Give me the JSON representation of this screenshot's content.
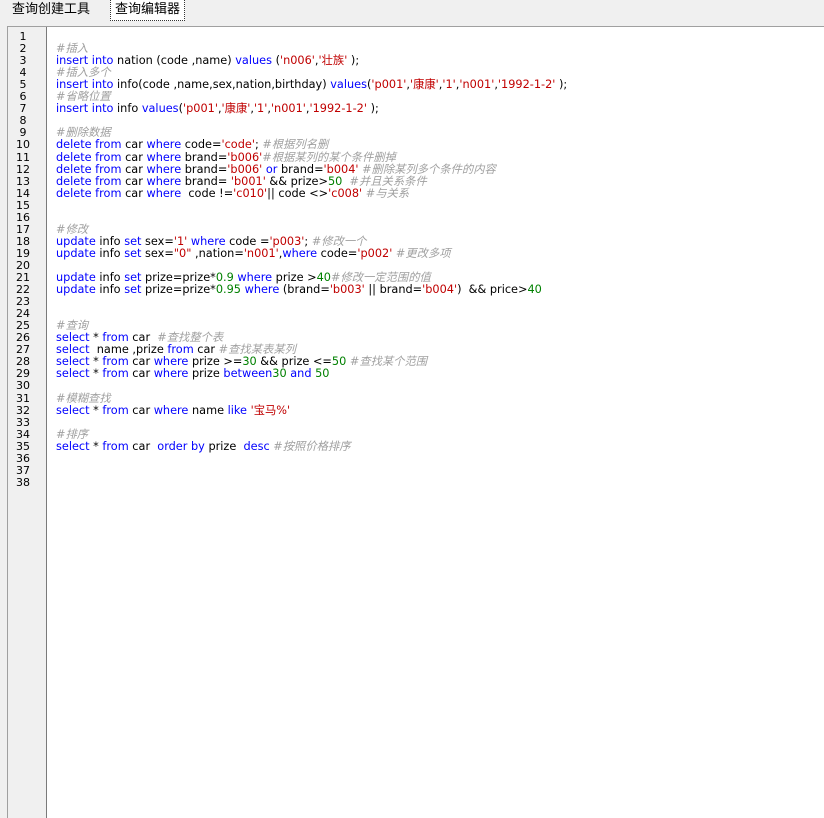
{
  "tabs": [
    {
      "label": "查询创建工具"
    },
    {
      "label": "查询编辑器"
    }
  ],
  "editor": {
    "line_count": 38,
    "lines": [
      [],
      [
        {
          "t": "cmt",
          "v": "#插入"
        }
      ],
      [
        {
          "t": "kw",
          "v": "insert into"
        },
        {
          "t": "txt",
          "v": " nation (code ,name) "
        },
        {
          "t": "kw",
          "v": "values"
        },
        {
          "t": "txt",
          "v": " ("
        },
        {
          "t": "str",
          "v": "'n006'"
        },
        {
          "t": "txt",
          "v": ","
        },
        {
          "t": "str",
          "v": "'壮族'"
        },
        {
          "t": "txt",
          "v": " );"
        }
      ],
      [
        {
          "t": "cmt",
          "v": "#插入多个"
        }
      ],
      [
        {
          "t": "kw",
          "v": "insert into"
        },
        {
          "t": "txt",
          "v": " info(code ,name,sex,nation,birthday) "
        },
        {
          "t": "kw",
          "v": "values"
        },
        {
          "t": "txt",
          "v": "("
        },
        {
          "t": "str",
          "v": "'p001'"
        },
        {
          "t": "txt",
          "v": ","
        },
        {
          "t": "str",
          "v": "'康康'"
        },
        {
          "t": "txt",
          "v": ","
        },
        {
          "t": "str",
          "v": "'1'"
        },
        {
          "t": "txt",
          "v": ","
        },
        {
          "t": "str",
          "v": "'n001'"
        },
        {
          "t": "txt",
          "v": ","
        },
        {
          "t": "str",
          "v": "'1992-1-2'"
        },
        {
          "t": "txt",
          "v": " );"
        }
      ],
      [
        {
          "t": "cmt",
          "v": "#省略位置"
        }
      ],
      [
        {
          "t": "kw",
          "v": "insert into"
        },
        {
          "t": "txt",
          "v": " info "
        },
        {
          "t": "kw",
          "v": "values"
        },
        {
          "t": "txt",
          "v": "("
        },
        {
          "t": "str",
          "v": "'p001'"
        },
        {
          "t": "txt",
          "v": ","
        },
        {
          "t": "str",
          "v": "'康康'"
        },
        {
          "t": "txt",
          "v": ","
        },
        {
          "t": "str",
          "v": "'1'"
        },
        {
          "t": "txt",
          "v": ","
        },
        {
          "t": "str",
          "v": "'n001'"
        },
        {
          "t": "txt",
          "v": ","
        },
        {
          "t": "str",
          "v": "'1992-1-2'"
        },
        {
          "t": "txt",
          "v": " );"
        }
      ],
      [],
      [
        {
          "t": "cmt",
          "v": "#删除数据"
        }
      ],
      [
        {
          "t": "kw",
          "v": "delete from"
        },
        {
          "t": "txt",
          "v": " car "
        },
        {
          "t": "kw",
          "v": "where"
        },
        {
          "t": "txt",
          "v": " code="
        },
        {
          "t": "str",
          "v": "'code'"
        },
        {
          "t": "txt",
          "v": "; "
        },
        {
          "t": "cmt",
          "v": "#根据列名删"
        }
      ],
      [
        {
          "t": "kw",
          "v": "delete from"
        },
        {
          "t": "txt",
          "v": " car "
        },
        {
          "t": "kw",
          "v": "where"
        },
        {
          "t": "txt",
          "v": " brand="
        },
        {
          "t": "str",
          "v": "'b006'"
        },
        {
          "t": "cmt",
          "v": "#根据某列的某个条件删掉"
        }
      ],
      [
        {
          "t": "kw",
          "v": "delete from"
        },
        {
          "t": "txt",
          "v": " car "
        },
        {
          "t": "kw",
          "v": "where"
        },
        {
          "t": "txt",
          "v": " brand="
        },
        {
          "t": "str",
          "v": "'b006'"
        },
        {
          "t": "txt",
          "v": " "
        },
        {
          "t": "kw",
          "v": "or"
        },
        {
          "t": "txt",
          "v": " brand="
        },
        {
          "t": "str",
          "v": "'b004'"
        },
        {
          "t": "txt",
          "v": " "
        },
        {
          "t": "cmt",
          "v": "#删除某列多个条件的内容"
        }
      ],
      [
        {
          "t": "kw",
          "v": "delete from"
        },
        {
          "t": "txt",
          "v": " car "
        },
        {
          "t": "kw",
          "v": "where"
        },
        {
          "t": "txt",
          "v": " brand= "
        },
        {
          "t": "str",
          "v": "'b001'"
        },
        {
          "t": "txt",
          "v": " && prize>"
        },
        {
          "t": "num",
          "v": "50"
        },
        {
          "t": "txt",
          "v": "  "
        },
        {
          "t": "cmt",
          "v": "#并且关系条件"
        }
      ],
      [
        {
          "t": "kw",
          "v": "delete from"
        },
        {
          "t": "txt",
          "v": " car "
        },
        {
          "t": "kw",
          "v": "where"
        },
        {
          "t": "txt",
          "v": "  code !="
        },
        {
          "t": "str",
          "v": "'c010'"
        },
        {
          "t": "txt",
          "v": "|| code <>"
        },
        {
          "t": "str",
          "v": "'c008'"
        },
        {
          "t": "txt",
          "v": " "
        },
        {
          "t": "cmt",
          "v": "#与关系"
        }
      ],
      [],
      [],
      [
        {
          "t": "cmt",
          "v": "#修改"
        }
      ],
      [
        {
          "t": "kw",
          "v": "update"
        },
        {
          "t": "txt",
          "v": " info "
        },
        {
          "t": "kw",
          "v": "set"
        },
        {
          "t": "txt",
          "v": " sex="
        },
        {
          "t": "str",
          "v": "'1'"
        },
        {
          "t": "txt",
          "v": " "
        },
        {
          "t": "kw",
          "v": "where"
        },
        {
          "t": "txt",
          "v": " code ="
        },
        {
          "t": "str",
          "v": "'p003'"
        },
        {
          "t": "txt",
          "v": "; "
        },
        {
          "t": "cmt",
          "v": "#修改一个"
        }
      ],
      [
        {
          "t": "kw",
          "v": "update"
        },
        {
          "t": "txt",
          "v": " info "
        },
        {
          "t": "kw",
          "v": "set"
        },
        {
          "t": "txt",
          "v": " sex="
        },
        {
          "t": "str",
          "v": "\"0\""
        },
        {
          "t": "txt",
          "v": " ,nation="
        },
        {
          "t": "str",
          "v": "'n001'"
        },
        {
          "t": "txt",
          "v": ","
        },
        {
          "t": "kw",
          "v": "where"
        },
        {
          "t": "txt",
          "v": " code="
        },
        {
          "t": "str",
          "v": "'p002'"
        },
        {
          "t": "txt",
          "v": " "
        },
        {
          "t": "cmt",
          "v": "#更改多项"
        }
      ],
      [],
      [
        {
          "t": "kw",
          "v": "update"
        },
        {
          "t": "txt",
          "v": " info "
        },
        {
          "t": "kw",
          "v": "set"
        },
        {
          "t": "txt",
          "v": " prize=prize*"
        },
        {
          "t": "num",
          "v": "0.9"
        },
        {
          "t": "txt",
          "v": " "
        },
        {
          "t": "kw",
          "v": "where"
        },
        {
          "t": "txt",
          "v": " prize >"
        },
        {
          "t": "num",
          "v": "40"
        },
        {
          "t": "cmt",
          "v": "#修改一定范围的值"
        }
      ],
      [
        {
          "t": "kw",
          "v": "update"
        },
        {
          "t": "txt",
          "v": " info "
        },
        {
          "t": "kw",
          "v": "set"
        },
        {
          "t": "txt",
          "v": " prize=prize*"
        },
        {
          "t": "num",
          "v": "0.95"
        },
        {
          "t": "txt",
          "v": " "
        },
        {
          "t": "kw",
          "v": "where"
        },
        {
          "t": "txt",
          "v": " (brand="
        },
        {
          "t": "str",
          "v": "'b003'"
        },
        {
          "t": "txt",
          "v": " || brand="
        },
        {
          "t": "str",
          "v": "'b004'"
        },
        {
          "t": "txt",
          "v": ")  && price>"
        },
        {
          "t": "num",
          "v": "40"
        }
      ],
      [],
      [],
      [
        {
          "t": "cmt",
          "v": "#查询"
        }
      ],
      [
        {
          "t": "kw",
          "v": "select"
        },
        {
          "t": "txt",
          "v": " * "
        },
        {
          "t": "kw",
          "v": "from"
        },
        {
          "t": "txt",
          "v": " car  "
        },
        {
          "t": "cmt",
          "v": "#查找整个表"
        }
      ],
      [
        {
          "t": "kw",
          "v": "select"
        },
        {
          "t": "txt",
          "v": "  name ,prize "
        },
        {
          "t": "kw",
          "v": "from"
        },
        {
          "t": "txt",
          "v": " car "
        },
        {
          "t": "cmt",
          "v": "#查找某表某列"
        }
      ],
      [
        {
          "t": "kw",
          "v": "select"
        },
        {
          "t": "txt",
          "v": " * "
        },
        {
          "t": "kw",
          "v": "from"
        },
        {
          "t": "txt",
          "v": " car "
        },
        {
          "t": "kw",
          "v": "where"
        },
        {
          "t": "txt",
          "v": " prize >="
        },
        {
          "t": "num",
          "v": "30"
        },
        {
          "t": "txt",
          "v": " && prize <="
        },
        {
          "t": "num",
          "v": "50"
        },
        {
          "t": "txt",
          "v": " "
        },
        {
          "t": "cmt",
          "v": "#查找某个范围"
        }
      ],
      [
        {
          "t": "kw",
          "v": "select"
        },
        {
          "t": "txt",
          "v": " * "
        },
        {
          "t": "kw",
          "v": "from"
        },
        {
          "t": "txt",
          "v": " car "
        },
        {
          "t": "kw",
          "v": "where"
        },
        {
          "t": "txt",
          "v": " prize "
        },
        {
          "t": "kw",
          "v": "between"
        },
        {
          "t": "num",
          "v": "30"
        },
        {
          "t": "txt",
          "v": " "
        },
        {
          "t": "kw",
          "v": "and"
        },
        {
          "t": "txt",
          "v": " "
        },
        {
          "t": "num",
          "v": "50"
        }
      ],
      [],
      [
        {
          "t": "cmt",
          "v": "#模糊查找"
        }
      ],
      [
        {
          "t": "kw",
          "v": "select"
        },
        {
          "t": "txt",
          "v": " * "
        },
        {
          "t": "kw",
          "v": "from"
        },
        {
          "t": "txt",
          "v": " car "
        },
        {
          "t": "kw",
          "v": "where"
        },
        {
          "t": "txt",
          "v": " name "
        },
        {
          "t": "kw",
          "v": "like"
        },
        {
          "t": "txt",
          "v": " "
        },
        {
          "t": "str",
          "v": "'宝马%'"
        }
      ],
      [],
      [
        {
          "t": "cmt",
          "v": "#排序"
        }
      ],
      [
        {
          "t": "kw",
          "v": "select"
        },
        {
          "t": "txt",
          "v": " * "
        },
        {
          "t": "kw",
          "v": "from"
        },
        {
          "t": "txt",
          "v": " car  "
        },
        {
          "t": "kw",
          "v": "order by"
        },
        {
          "t": "txt",
          "v": " prize  "
        },
        {
          "t": "kw",
          "v": "desc"
        },
        {
          "t": "txt",
          "v": " "
        },
        {
          "t": "cmt",
          "v": "#按照价格排序"
        }
      ],
      [],
      [],
      []
    ]
  },
  "colors": {
    "keyword": "#0000ff",
    "string": "#c00000",
    "number": "#008000",
    "comment": "#a0a0a0",
    "text": "#000000"
  }
}
